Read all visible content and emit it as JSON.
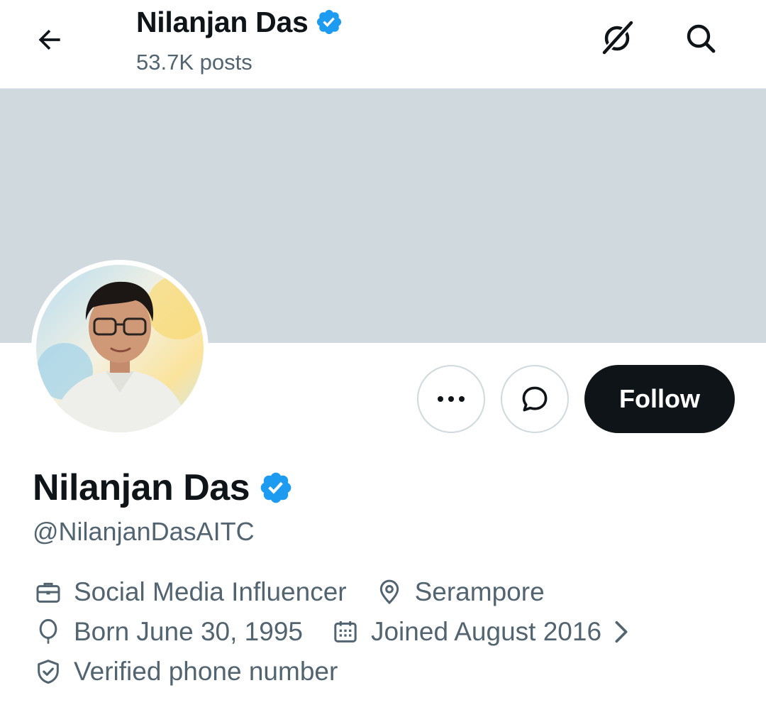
{
  "header": {
    "name": "Nilanjan Das",
    "posts": "53.7K posts"
  },
  "icons": {
    "back": "arrow-left-icon",
    "grok": "grok-icon",
    "search": "search-icon",
    "verified": "verified-badge-icon",
    "more": "more-dots-icon",
    "message": "message-bubble-icon",
    "profession": "briefcase-icon",
    "location": "location-pin-icon",
    "birthday": "balloon-icon",
    "joined": "calendar-icon",
    "phone": "shield-check-icon",
    "chevron": "chevron-right-icon"
  },
  "colors": {
    "verified": "#1d9bf0",
    "banner": "#cfd9de",
    "follow_bg": "#0f1419",
    "secondary_text": "#536471"
  },
  "actions": {
    "follow_label": "Follow"
  },
  "profile": {
    "name": "Nilanjan Das",
    "handle": "@NilanjanDasAITC",
    "profession": "Social Media Influencer",
    "location": "Serampore",
    "birthday": "Born June 30, 1995",
    "joined": "Joined August 2016",
    "phone": "Verified phone number"
  }
}
